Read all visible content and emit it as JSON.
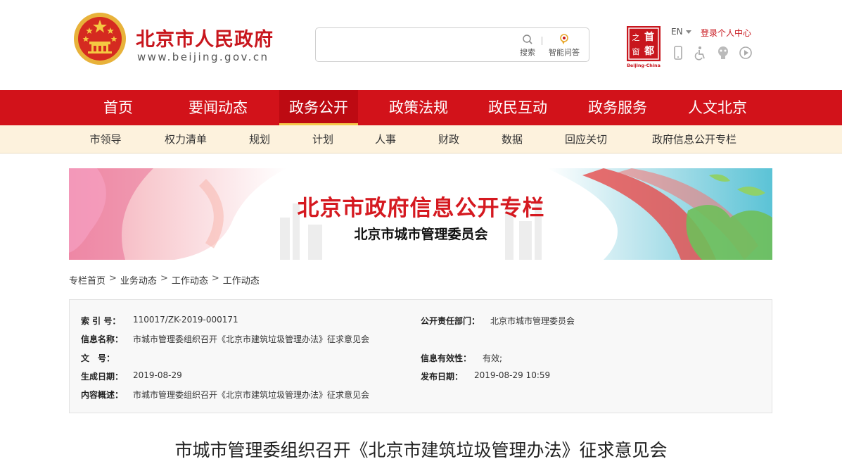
{
  "header": {
    "site_name": "北京市人民政府",
    "site_url": "www.beijing.gov.cn",
    "search": {
      "placeholder": "",
      "button_label": "搜索",
      "qa_label": "智能问答"
    },
    "capital_logo_text": "Beijing-China",
    "capital_logo_chars": [
      "首",
      "都",
      "之",
      "窗"
    ],
    "language_label": "EN",
    "login_label": "登录个人中心",
    "tool_icons": [
      "mobile-icon",
      "accessibility-icon",
      "elder-mode-icon",
      "audio-play-icon"
    ]
  },
  "main_nav": {
    "items": [
      {
        "label": "首页"
      },
      {
        "label": "要闻动态"
      },
      {
        "label": "政务公开",
        "active": true
      },
      {
        "label": "政策法规"
      },
      {
        "label": "政民互动"
      },
      {
        "label": "政务服务"
      },
      {
        "label": "人文北京"
      }
    ]
  },
  "sub_nav": {
    "items": [
      {
        "label": "市领导"
      },
      {
        "label": "权力清单"
      },
      {
        "label": "规划"
      },
      {
        "label": "计划"
      },
      {
        "label": "人事"
      },
      {
        "label": "财政"
      },
      {
        "label": "数据"
      },
      {
        "label": "回应关切"
      },
      {
        "label": "政府信息公开专栏"
      }
    ]
  },
  "banner": {
    "title": "北京市政府信息公开专栏",
    "subtitle": "北京市城市管理委员会"
  },
  "breadcrumb": [
    "专栏首页",
    "业务动态",
    "工作动态",
    "工作动态"
  ],
  "info": {
    "index_label": "索 引 号：",
    "index_value": "110017/ZK-2019-000171",
    "dept_label": "公开责任部门：",
    "dept_value": "北京市城市管理委员会",
    "name_label": "信息名称：",
    "name_value": "市城市管理委组织召开《北京市建筑垃圾管理办法》征求意见会",
    "doc_label": "文　号：",
    "doc_value": "",
    "validity_label": "信息有效性：",
    "validity_value": "有效;",
    "created_label": "生成日期：",
    "created_value": "2019-08-29",
    "published_label": "发布日期：",
    "published_value": "2019-08-29 10:59",
    "summary_label": "内容概述：",
    "summary_value": "市城市管理委组织召开《北京市建筑垃圾管理办法》征求意见会"
  },
  "article": {
    "title": "市城市管理委组织召开《北京市建筑垃圾管理办法》征求意见会"
  },
  "colors": {
    "brand_red": "#d2121a",
    "sub_nav_bg": "#fdf2dd",
    "active_underline": "#f6c94a"
  }
}
